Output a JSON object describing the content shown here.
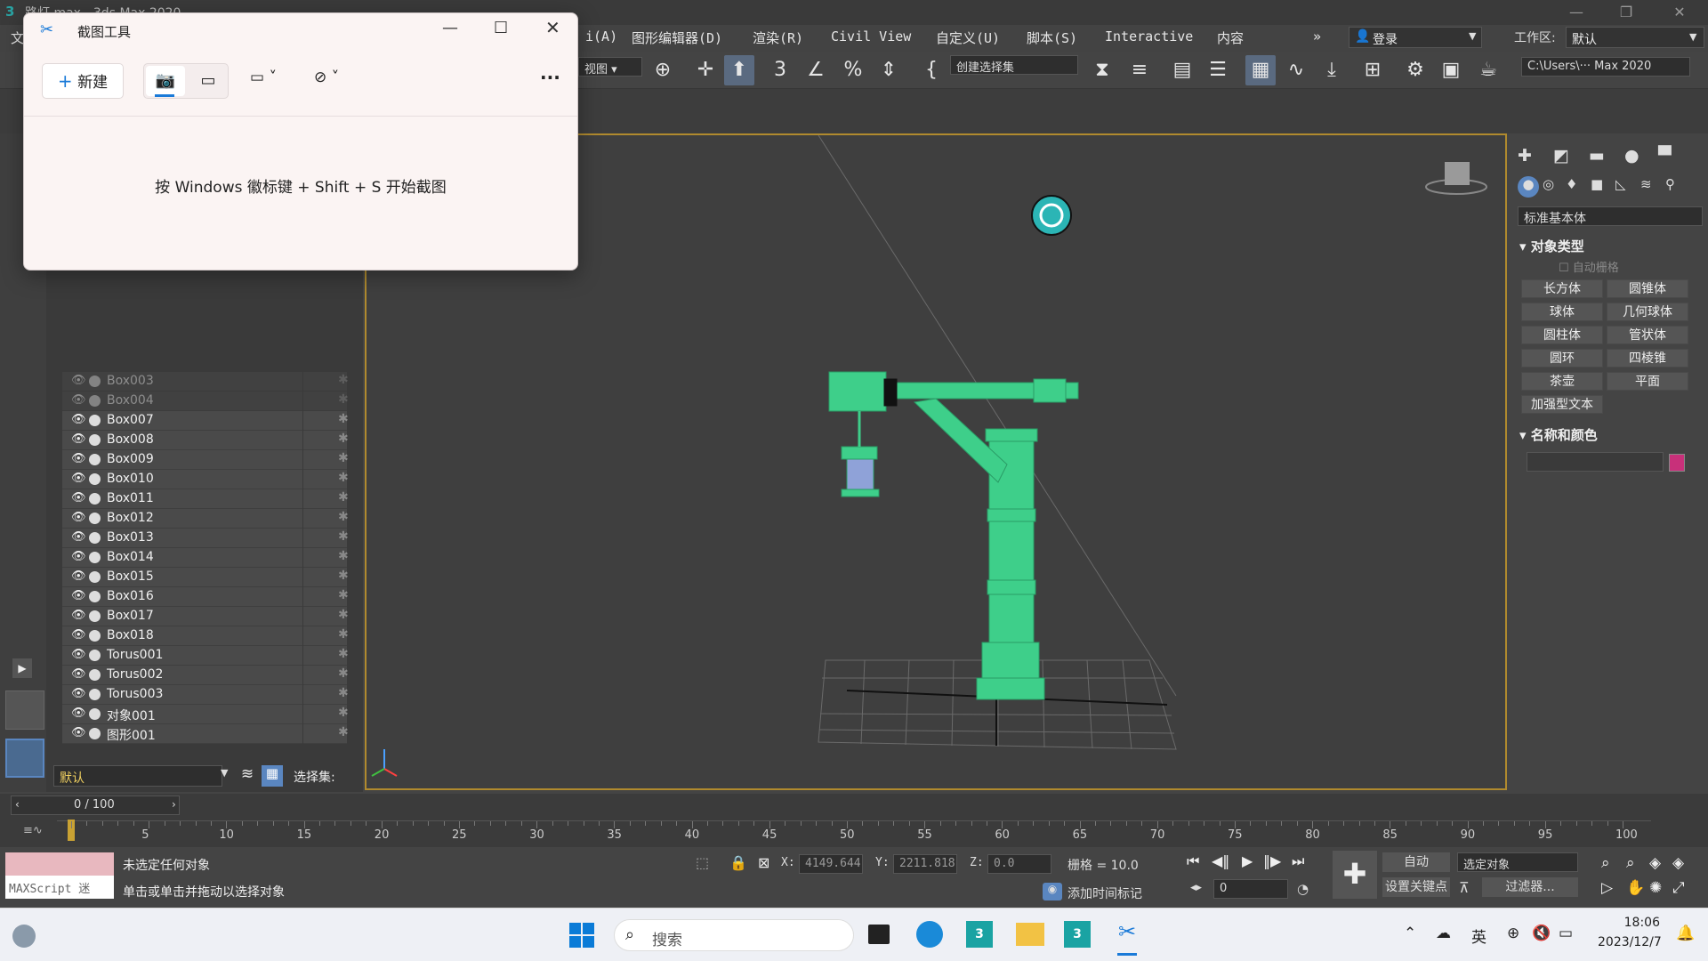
{
  "titlebar": {
    "title": "路灯.max - 3ds Max 2020",
    "minimize": "—",
    "restore": "❐",
    "close": "✕"
  },
  "menu": {
    "clipped_left": "文",
    "items": [
      "i(A)",
      "图形编辑器(D)",
      "渲染(R)",
      "Civil View",
      "自定义(U)",
      "脚本(S)",
      "Interactive",
      "内容"
    ],
    "overflow": "»",
    "login": "登录",
    "workspace_label": "工作区:",
    "workspace_value": "默认"
  },
  "toolbar": {
    "view_combo": "视图",
    "selection_set": "创建选择集",
    "path": "C:\\Users\\··· Max 2020"
  },
  "scene_explorer": {
    "rows": [
      "Box003",
      "Box004",
      "Box007",
      "Box008",
      "Box009",
      "Box010",
      "Box011",
      "Box012",
      "Box013",
      "Box014",
      "Box015",
      "Box016",
      "Box017",
      "Box018",
      "Torus001",
      "Torus002",
      "Torus003",
      "对象001",
      "图形001"
    ],
    "layer_value": "默认",
    "selection_set_label": "选择集:"
  },
  "command_panel": {
    "category": "标准基本体",
    "object_type_title": "对象类型",
    "auto_grid": "自动栅格",
    "buttons": [
      "长方体",
      "圆锥体",
      "球体",
      "几何球体",
      "圆柱体",
      "管状体",
      "圆环",
      "四棱锥",
      "茶壶",
      "平面",
      "加强型文本"
    ],
    "name_color_title": "名称和颜色",
    "object_color": "#c8307a"
  },
  "timeline": {
    "frame": "0 / 100",
    "ticks": [
      "5",
      "10",
      "15",
      "20",
      "25",
      "30",
      "35",
      "40",
      "45",
      "50",
      "55",
      "60",
      "65",
      "70",
      "75",
      "80",
      "85",
      "90",
      "95",
      "100"
    ]
  },
  "status": {
    "maxscript": "MAXScript 迷",
    "msg1": "未选定任何对象",
    "msg2": "单击或单击并拖动以选择对象",
    "x_label": "X:",
    "x_value": "4149.644",
    "y_label": "Y:",
    "y_value": "2211.818",
    "z_label": "Z:",
    "z_value": "0.0",
    "grid": "栅格 = 10.0",
    "add_time_tag": "添加时间标记",
    "auto": "自动",
    "selected_object": "选定对象",
    "set_key": "设置关键点",
    "filters": "过滤器...",
    "frame_spinner": "0"
  },
  "snip": {
    "title": "截图工具",
    "new": "新建",
    "more": "···",
    "hint": "按 Windows 徽标键 + Shift + S 开始截图"
  },
  "taskbar": {
    "search": "搜索",
    "lang": "英",
    "time": "18:06",
    "date": "2023/12/7"
  }
}
